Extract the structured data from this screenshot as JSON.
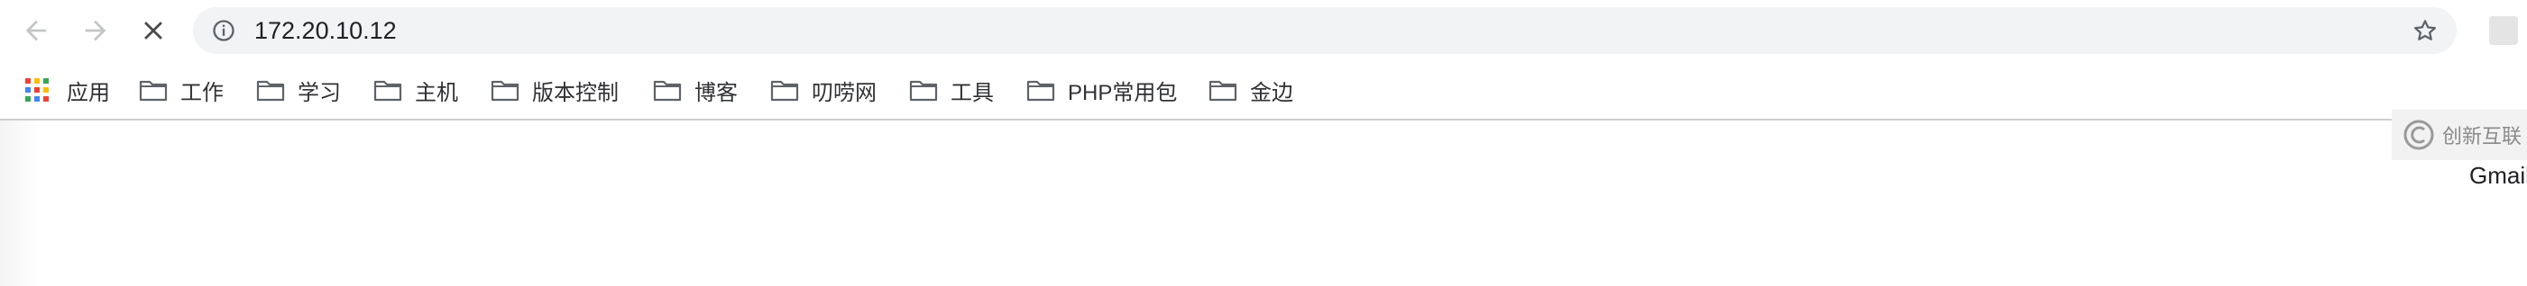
{
  "toolbar": {
    "url": "172.20.10.12",
    "icons": {
      "back": "arrow-left-icon",
      "forward": "arrow-right-icon",
      "stop": "close-icon",
      "info": "info-icon",
      "bookmark": "star-icon"
    }
  },
  "bookmarks": {
    "apps_label": "应用",
    "items": [
      {
        "label": "工作"
      },
      {
        "label": "学习"
      },
      {
        "label": "主机"
      },
      {
        "label": "版本控制"
      },
      {
        "label": "博客"
      },
      {
        "label": "叨唠网"
      },
      {
        "label": "工具"
      },
      {
        "label": "PHP常用包"
      },
      {
        "label": "金边"
      }
    ],
    "apps_colors": [
      "#ea4335",
      "#fbbc04",
      "#34a853",
      "#4285f4",
      "#ea4335",
      "#fbbc04",
      "#34a853",
      "#4285f4",
      "#ea4335"
    ]
  },
  "page": {
    "gmail_label": "Gmail"
  },
  "watermark": {
    "text": "创新互联"
  }
}
